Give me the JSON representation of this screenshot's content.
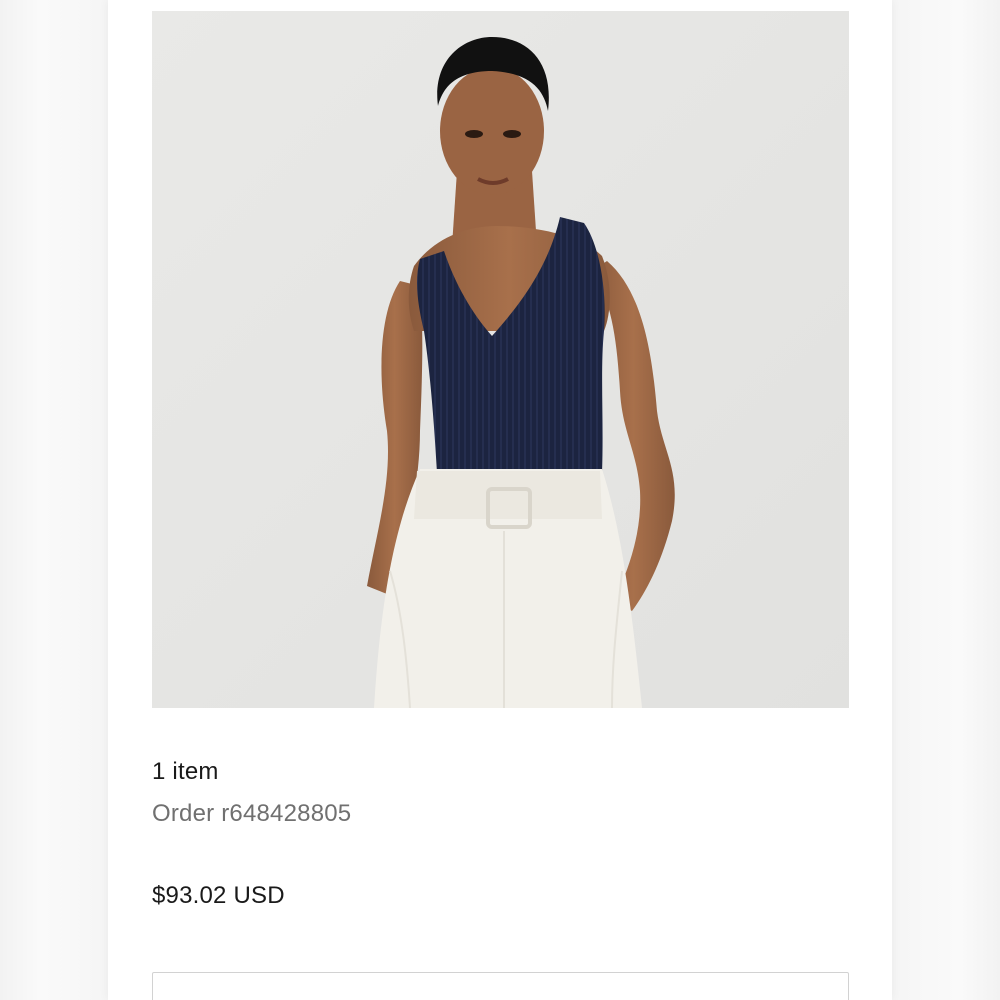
{
  "order": {
    "item_count": "1 item",
    "order_number": "Order r648428805",
    "total": "$93.02 USD"
  },
  "product_image": {
    "alt": "Model wearing navy ribbed knit v-neck tank with white belted trousers"
  },
  "colors": {
    "image_background": "#e6e6e4",
    "top_navy": "#1c2440",
    "pants_white": "#f2f0ea",
    "text_primary": "#1a1a1a",
    "text_secondary": "#707070"
  }
}
